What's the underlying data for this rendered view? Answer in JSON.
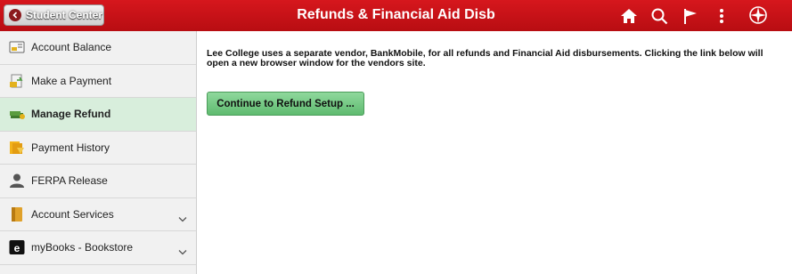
{
  "header": {
    "back_label": "Student Center",
    "title": "Refunds & Financial Aid Disb",
    "bg_color": "#c8121a",
    "icons": [
      "home-icon",
      "search-icon",
      "flag-icon",
      "more-icon",
      "navbar-compass-icon"
    ]
  },
  "sidebar": {
    "active_color": "#d8eedc",
    "items": [
      {
        "label": "Account Balance",
        "icon": "account-balance-icon",
        "expandable": false
      },
      {
        "label": "Make a Payment",
        "icon": "payment-icon",
        "expandable": false
      },
      {
        "label": "Manage Refund",
        "icon": "refund-icon",
        "expandable": false,
        "active": true
      },
      {
        "label": "Payment History",
        "icon": "payment-history-icon",
        "expandable": false
      },
      {
        "label": "FERPA Release",
        "icon": "person-icon",
        "expandable": false
      },
      {
        "label": "Account Services",
        "icon": "folder-icon",
        "expandable": true
      },
      {
        "label": "myBooks - Bookstore",
        "icon": "bookstore-icon",
        "expandable": true
      }
    ]
  },
  "main": {
    "intro_text": "Lee College uses a separate vendor, BankMobile, for all refunds and Financial Aid disbursements. Clicking the link below will open a new browser window for the vendors site.",
    "button_label": "Continue to Refund Setup ...",
    "button_color": "#6cc47c"
  }
}
